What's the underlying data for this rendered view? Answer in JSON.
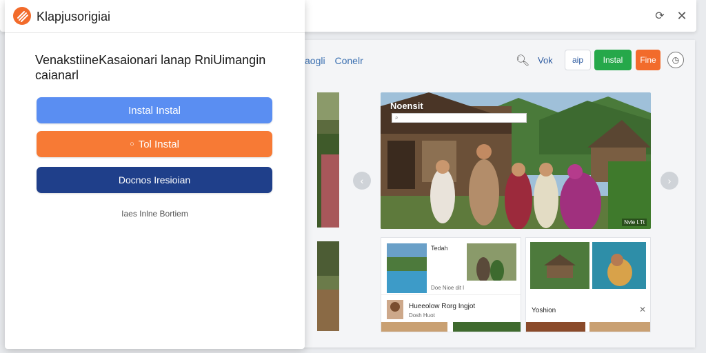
{
  "window": {
    "refresh_icon": "refresh-icon",
    "close_icon": "close-icon"
  },
  "modal": {
    "app_title": "Klapjusorigiai",
    "heading": "Venakstiine​Kasaionari lanap RniUimangin caianarl",
    "buttons": [
      {
        "label": "Instal Instal",
        "color": "#5a8ef2"
      },
      {
        "label": "Tol Instal",
        "color": "#f77a35",
        "icon": "○"
      },
      {
        "label": "Docnos Iresioian",
        "color": "#1f3f8a"
      }
    ],
    "footer_link": "Iaes Inlne Bortiem",
    "logo_color": "#f26b2b"
  },
  "browser": {
    "breadcrumb": [
      "aogli",
      "Conelr"
    ],
    "header_link": "Vok",
    "sign_btn": "aip",
    "install_btn": "Instal",
    "free_btn": "Fine",
    "hero": {
      "title": "Noensit",
      "badge": "Nvle I.Tt"
    },
    "card_a": {
      "label_top": "Tedah",
      "label_date": "Doe Nioe dit l",
      "title": "Hueeolow Rorg Ingjot",
      "subtitle": "Dosh Huot"
    },
    "card_b": {
      "title": "Yoshion"
    }
  },
  "colors": {
    "accent_green": "#25a84a",
    "accent_orange": "#f26b2b",
    "link_blue": "#2c5aa0"
  }
}
